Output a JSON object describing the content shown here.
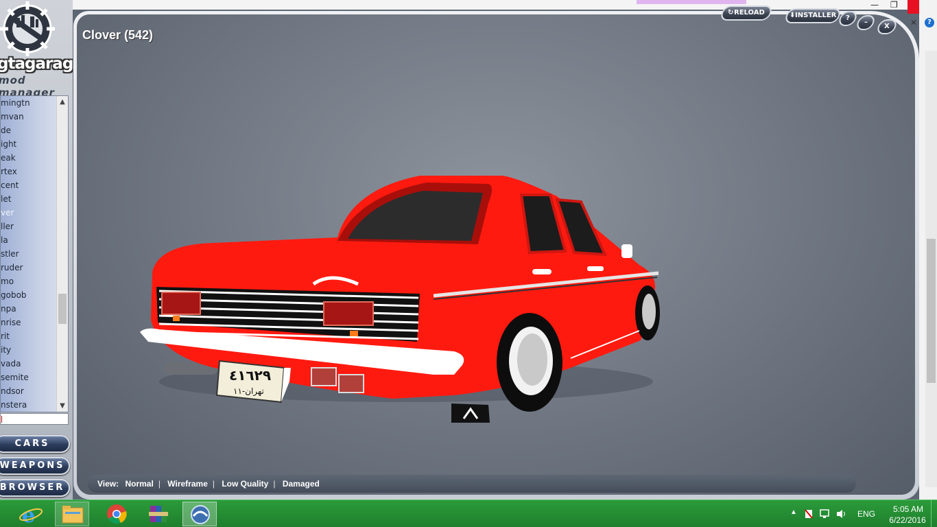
{
  "app": {
    "logo_text": "gtagarage",
    "logo_subtitle": "mod manager"
  },
  "vehicle_list": {
    "items": [
      "mingtn",
      "mvan",
      "de",
      "ight",
      "eak",
      "rtex",
      "cent",
      "let",
      "ver",
      "ller",
      "la",
      "stler",
      "ruder",
      "mo",
      "gobob",
      "npa",
      "nrise",
      "rit",
      "ity",
      "vada",
      "semite",
      "ndsor",
      "nstera"
    ],
    "selected_index": 8
  },
  "nav": {
    "cars": "CARS",
    "weapons": "WEAPONS",
    "browser": "BROWSER"
  },
  "viewer": {
    "title": "Clover (542)",
    "plate_text": "٤١٦٢٩",
    "plate_city": "تهران-١١",
    "car_color": "#ff1a10"
  },
  "window_buttons": {
    "reload": "RELOAD",
    "installer": "INSTALLER",
    "help": "?",
    "minimize": "–",
    "close": "X"
  },
  "view_bar": {
    "label": "View:",
    "options": [
      "Normal",
      "Wireframe",
      "Low Quality",
      "Damaged"
    ]
  },
  "taskbar": {
    "language": "ENG",
    "time": "5:05 AM",
    "date": "6/22/2016"
  },
  "colors": {
    "taskbar": "#229233",
    "viewer_bg": "#6f7682",
    "nav_button": "#2c3c5c"
  }
}
